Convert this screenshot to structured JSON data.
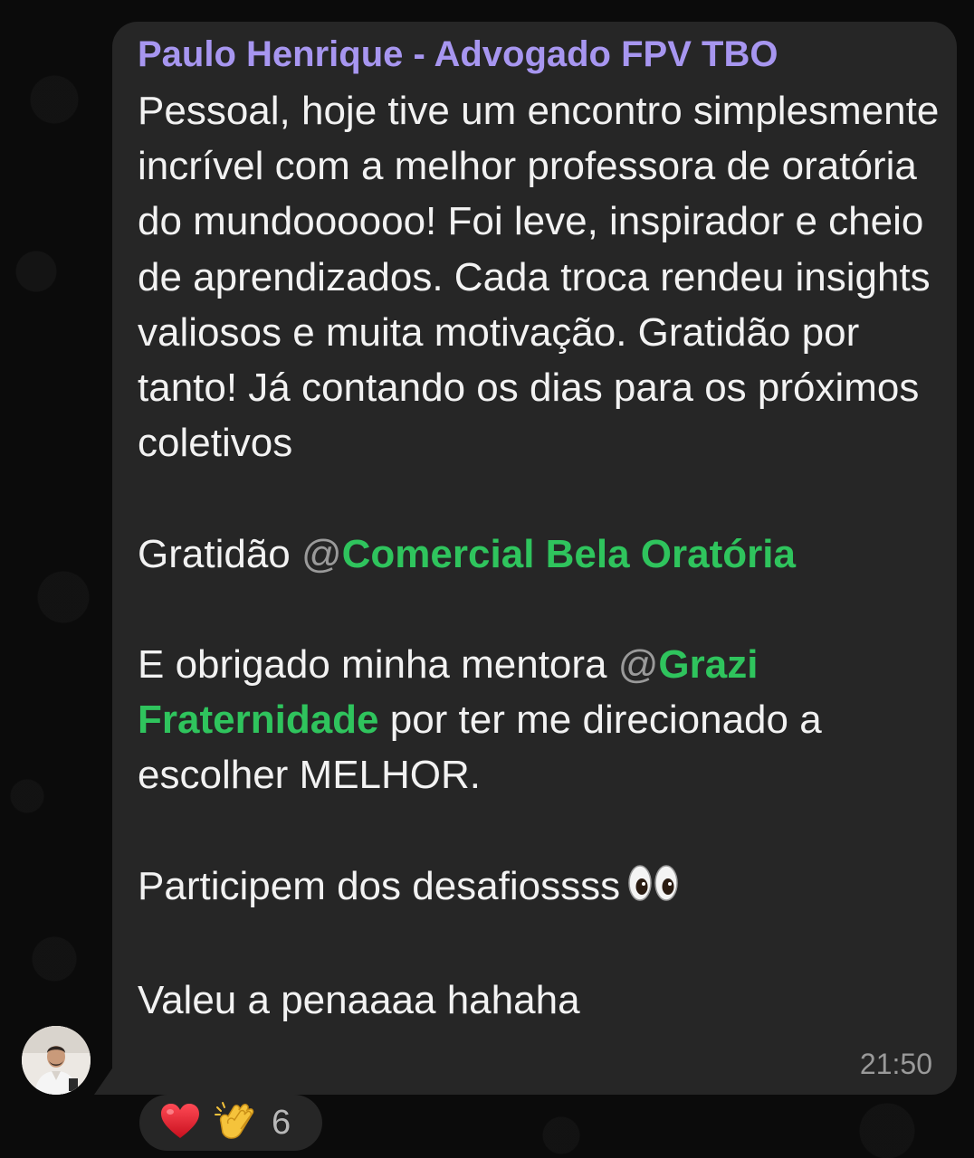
{
  "message": {
    "sender": "Paulo Henrique - Advogado FPV TBO",
    "paragraph_1": "Pessoal, hoje tive um encontro simplesmente incrível com a melhor professora de oratória do mundoooooo! Foi leve, inspirador e cheio de aprendizados. Cada troca rendeu insights valiosos e muita motivação. Gratidão por tanto! Já contando os dias para os próximos coletivos",
    "paragraph_2_prefix": "Gratidão ",
    "mention_1": "Comercial Bela Oratória",
    "paragraph_3_prefix": "E obrigado minha mentora ",
    "mention_2": "Grazi Fraternidade",
    "paragraph_3_suffix": " por ter me direcionado a escolher MELHOR.",
    "paragraph_4": "Participem dos desafiossss",
    "paragraph_5": "Valeu a penaaaa hahaha",
    "mention_symbol": "@",
    "time": "21:50"
  },
  "reactions": {
    "icons": [
      "heart-icon",
      "clapping-hands-icon"
    ],
    "count": "6"
  },
  "colors": {
    "sender": "#a796f0",
    "mention": "#2fc45d",
    "bubble": "#262626",
    "background": "#0b0b0b"
  }
}
